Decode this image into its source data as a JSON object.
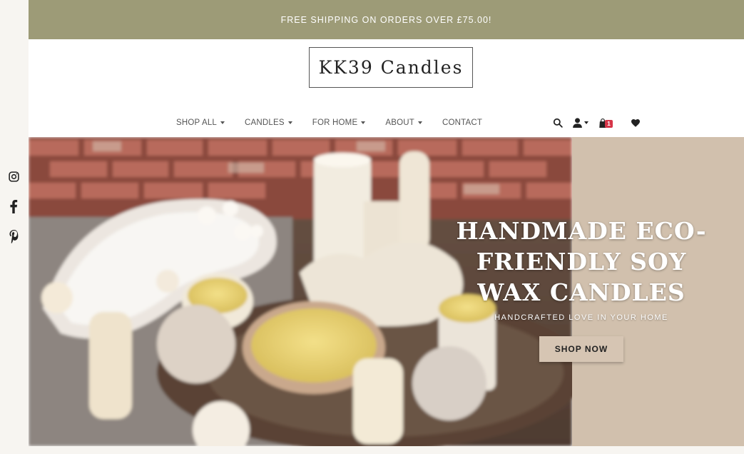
{
  "promo": {
    "text": "FREE SHIPPING ON ORDERS OVER £75.00!"
  },
  "brand": {
    "logo_text": "KK39 Candles"
  },
  "social": [
    {
      "icon": "instagram-icon"
    },
    {
      "icon": "facebook-icon"
    },
    {
      "icon": "pinterest-icon"
    }
  ],
  "nav": {
    "items": [
      {
        "label": "SHOP ALL",
        "dropdown": true
      },
      {
        "label": "CANDLES",
        "dropdown": true
      },
      {
        "label": "FOR HOME",
        "dropdown": true
      },
      {
        "label": "ABOUT",
        "dropdown": true
      },
      {
        "label": "CONTACT",
        "dropdown": false
      }
    ]
  },
  "header_icons": {
    "search": "search-icon",
    "account": "user-icon",
    "cart": "bag-icon",
    "cart_count": "1",
    "wishlist": "heart-icon"
  },
  "hero": {
    "title_line1": "HANDMADE ECO-",
    "title_line2": "FRIENDLY SOY",
    "title_line3": "WAX CANDLES",
    "subtitle": "HANDCRAFTED LOVE IN YOUR HOME",
    "cta_label": "SHOP NOW"
  },
  "colors": {
    "promo_bar": "#9d9b77",
    "hero_panel": "#d1c0ad",
    "badge": "#d63548"
  }
}
